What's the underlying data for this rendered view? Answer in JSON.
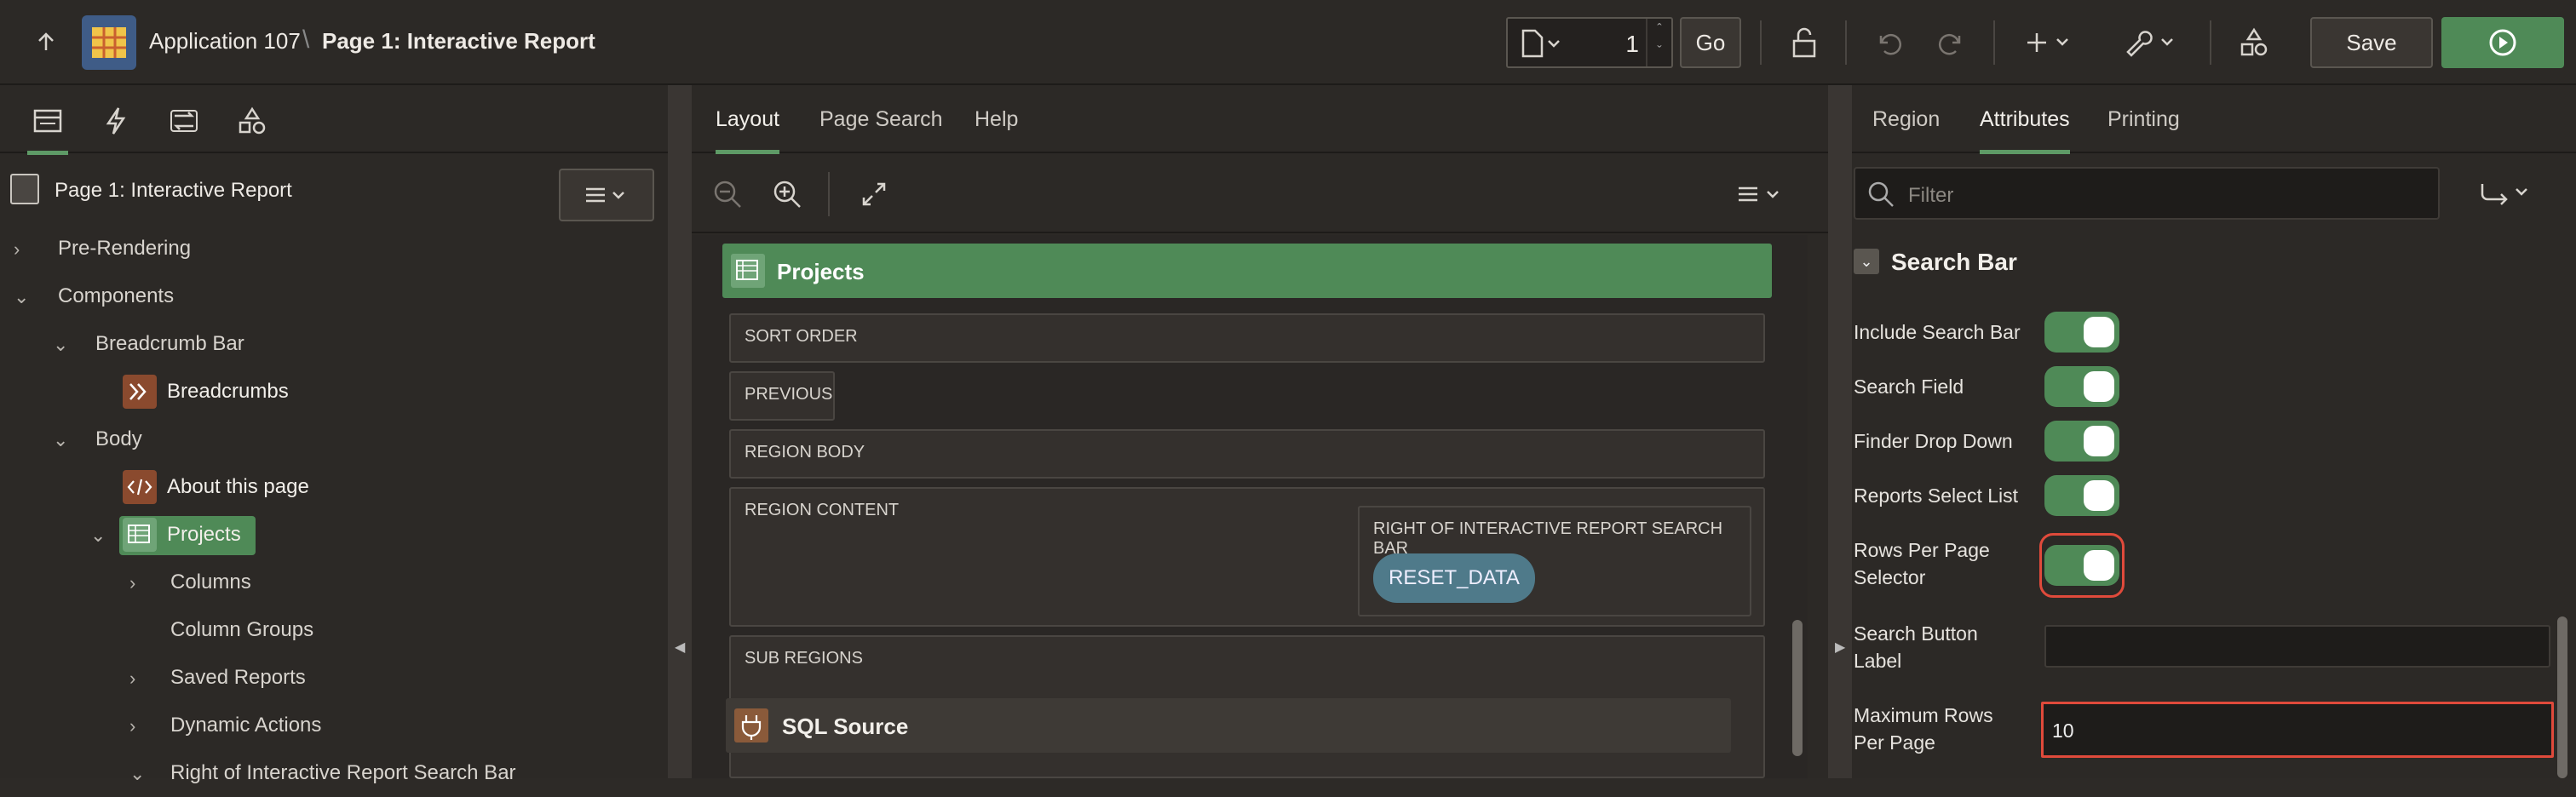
{
  "header": {
    "app_title": "Application 107",
    "separator": "\\",
    "page_title": "Page 1: Interactive Report",
    "page_number": "1",
    "go_label": "Go",
    "save_label": "Save"
  },
  "left": {
    "tree_root": "Page 1: Interactive Report",
    "tree": [
      {
        "label": "Pre-Rendering"
      },
      {
        "label": "Components"
      },
      {
        "label": "Breadcrumb Bar"
      },
      {
        "label": "Breadcrumbs"
      },
      {
        "label": "Body"
      },
      {
        "label": "About this page"
      },
      {
        "label": "Projects"
      },
      {
        "label": "Columns"
      },
      {
        "label": "Column Groups"
      },
      {
        "label": "Saved Reports"
      },
      {
        "label": "Dynamic Actions"
      },
      {
        "label": "Right of Interactive Report Search Bar"
      }
    ]
  },
  "middle": {
    "tabs": [
      {
        "label": "Layout"
      },
      {
        "label": "Page Search"
      },
      {
        "label": "Help"
      }
    ],
    "region_name": "Projects",
    "slots": {
      "sort_order": "SORT ORDER",
      "previous": "PREVIOUS",
      "region_body": "REGION BODY",
      "region_content": "REGION CONTENT",
      "right_of_search": "RIGHT OF INTERACTIVE REPORT SEARCH BAR",
      "reset_button": "RESET_DATA",
      "sub_regions": "SUB REGIONS",
      "sql_source": "SQL Source"
    }
  },
  "right": {
    "tabs": [
      {
        "label": "Region"
      },
      {
        "label": "Attributes"
      },
      {
        "label": "Printing"
      }
    ],
    "filter_placeholder": "Filter",
    "group_title": "Search Bar",
    "props": {
      "include_search_bar": "Include Search Bar",
      "search_field": "Search Field",
      "finder_drop_down": "Finder Drop Down",
      "reports_select_list": "Reports Select List",
      "rows_per_page_selector": "Rows Per Page Selector",
      "search_button_label": "Search Button Label",
      "maximum_rows_per_page": "Maximum Rows Per Page",
      "maximum_rows_value": "10"
    }
  },
  "colors": {
    "accent": "#4f8a57",
    "highlight": "#e04a3b",
    "reset_button": "#4f7a8a"
  }
}
